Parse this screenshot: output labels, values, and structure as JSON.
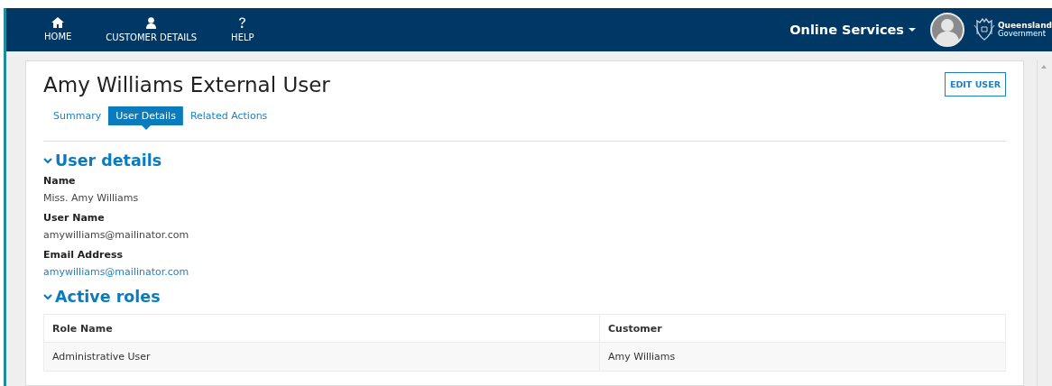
{
  "nav": {
    "items": [
      {
        "kind": "home",
        "label": "HOME"
      },
      {
        "kind": "person",
        "label": "CUSTOMER DETAILS"
      },
      {
        "kind": "help",
        "label": "HELP"
      }
    ],
    "menu": {
      "label": "Online Services",
      "expanded": false
    },
    "logo": {
      "line1": "Queensland",
      "line2": "Government"
    }
  },
  "page": {
    "title": "Amy Williams External User",
    "edit_button": "EDIT USER",
    "tabs": [
      {
        "label": "Summary",
        "selected": false
      },
      {
        "label": "User Details",
        "selected": true
      },
      {
        "label": "Related Actions",
        "selected": false
      }
    ]
  },
  "user_details": {
    "heading": "User details",
    "expanded": true,
    "fields": [
      {
        "kind": "text",
        "label": "Name",
        "value": "Miss. Amy Williams"
      },
      {
        "kind": "text",
        "label": "User Name",
        "value": "amywilliams@mailinator.com"
      },
      {
        "kind": "link",
        "label": "Email Address",
        "value": "amywilliams@mailinator.com"
      }
    ]
  },
  "active_roles": {
    "heading": "Active roles",
    "expanded": true,
    "table": {
      "columns": [
        "Role Name",
        "Customer"
      ],
      "rows": [
        [
          "Administrative User",
          "Amy Williams"
        ]
      ]
    }
  }
}
